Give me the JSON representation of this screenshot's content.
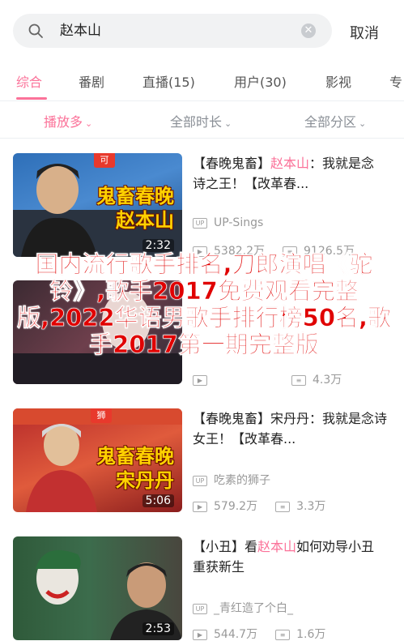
{
  "search": {
    "query": "赵本山",
    "cancel_label": "取消"
  },
  "tabs": [
    {
      "label": "综合",
      "active": true
    },
    {
      "label": "番剧"
    },
    {
      "label": "直播(15)"
    },
    {
      "label": "用户(30)"
    },
    {
      "label": "影视"
    },
    {
      "label": "专"
    }
  ],
  "filters": [
    {
      "label": "播放多",
      "active": true
    },
    {
      "label": "全部时长"
    },
    {
      "label": "全部分区"
    }
  ],
  "videos": [
    {
      "title_prefix": "【春晚鬼畜】",
      "title_highlight": "赵本山",
      "title_suffix": "：我就是念诗之王！【改革春...",
      "uploader": "UP-Sings",
      "plays": "5382.2万",
      "comments": "9126.5万",
      "duration": "2:32",
      "badge": "可",
      "caption_line1": "鬼畜春晚",
      "caption_line2": "赵本山"
    },
    {
      "plays": "",
      "comments": "4.3万"
    },
    {
      "title": "【春晚鬼畜】宋丹丹：我就是念诗女王！【改革春...",
      "uploader": "吃素的狮子",
      "plays": "579.2万",
      "comments": "3.3万",
      "duration": "5:06",
      "badge": "狮",
      "caption_line1": "鬼畜春晚",
      "caption_line2": "宋丹丹"
    },
    {
      "title_prefix": "【小丑】看",
      "title_highlight": "赵本山",
      "title_suffix": "如何劝导小丑重获新生",
      "uploader": "_青红造了个白_",
      "plays": "544.7万",
      "comments": "1.6万",
      "duration": "2:53"
    }
  ],
  "overlay_text": "国内流行歌手排名,刀郎演唱《驼铃》,歌手2017免费观看完整版,2022华语男歌手排行榜50名,歌手2017第一期完整版",
  "colors": {
    "accent": "#fb7299",
    "overlay": "#e00000"
  }
}
